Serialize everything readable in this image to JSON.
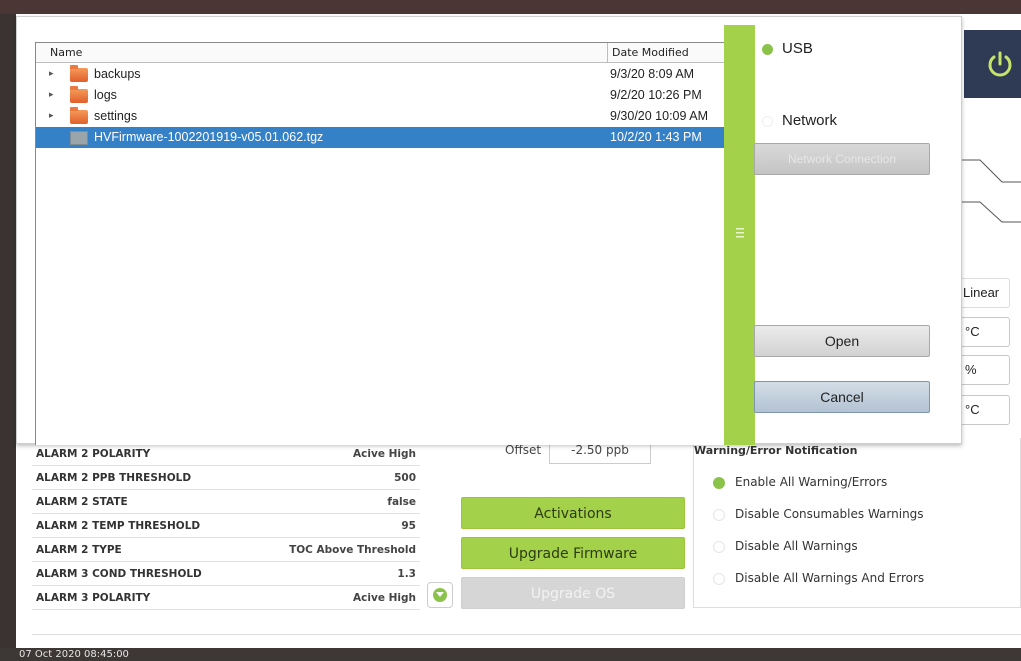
{
  "dialog": {
    "columns": {
      "name": "Name",
      "date_modified": "Date Modified"
    },
    "files": [
      {
        "name": "backups",
        "date": "9/3/20 8:09 AM",
        "type": "folder"
      },
      {
        "name": "logs",
        "date": "9/2/20 10:26 PM",
        "type": "folder"
      },
      {
        "name": "settings",
        "date": "9/30/20 10:09 AM",
        "type": "folder"
      },
      {
        "name": "HVFirmware-1002201919-v05.01.062.tgz",
        "date": "10/2/20 1:43 PM",
        "type": "file",
        "selected": true
      }
    ],
    "sources": {
      "usb": "USB",
      "network": "Network",
      "selected": "usb"
    },
    "network_connection_label": "Network Connection",
    "open_label": "Open",
    "cancel_label": "Cancel"
  },
  "background": {
    "right_chips": [
      "Linear",
      "°C",
      "%",
      "°C"
    ],
    "alarm_table": [
      {
        "key": "ALARM 2 POLARITY",
        "value": "Acive High"
      },
      {
        "key": "ALARM 2 PPB THRESHOLD",
        "value": "500"
      },
      {
        "key": "ALARM 2 STATE",
        "value": "false"
      },
      {
        "key": "ALARM 2 TEMP THRESHOLD",
        "value": "95"
      },
      {
        "key": "ALARM 2 TYPE",
        "value": "TOC Above Threshold"
      },
      {
        "key": "ALARM 3 COND THRESHOLD",
        "value": "1.3"
      },
      {
        "key": "ALARM 3 POLARITY",
        "value": "Acive High"
      }
    ],
    "offset": {
      "label": "Offset",
      "value": "-2.50 ppb"
    },
    "buttons": {
      "activations": "Activations",
      "upgrade_firmware": "Upgrade Firmware",
      "upgrade_os": "Upgrade OS"
    },
    "warning_panel": {
      "title": "Warning/Error Notification",
      "options": [
        "Enable All Warning/Errors",
        "Disable Consumables Warnings",
        "Disable All Warnings",
        "Disable All Warnings And Errors"
      ],
      "selected_index": 0
    },
    "status_time": "07 Oct 2020 08:45:00"
  },
  "colors": {
    "accent_green": "#a3d24a",
    "selection_blue": "#3581c8",
    "header_navy": "#2f3b55"
  }
}
